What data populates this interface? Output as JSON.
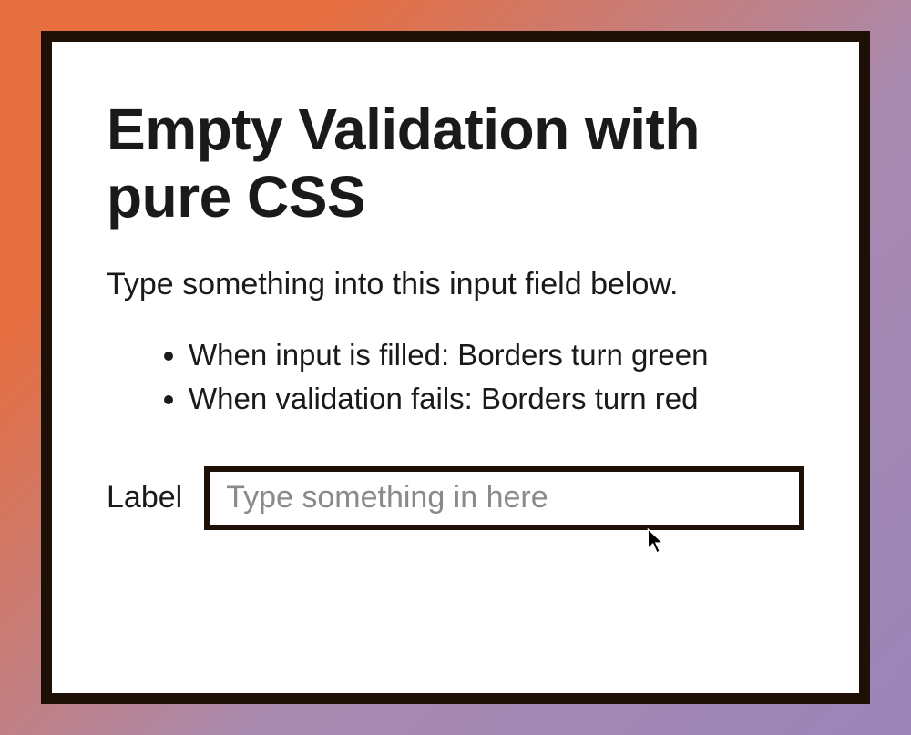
{
  "heading": "Empty Validation with pure CSS",
  "subtitle": "Type something into this input field below.",
  "rules": {
    "filled": "When input is filled: Borders turn green",
    "invalid": "When validation fails: Borders turn red"
  },
  "form": {
    "label": "Label",
    "placeholder": "Type something in here",
    "value": ""
  },
  "colors": {
    "border": "#1e0f07",
    "valid": "#2e8b57",
    "invalid": "#c0392b"
  }
}
